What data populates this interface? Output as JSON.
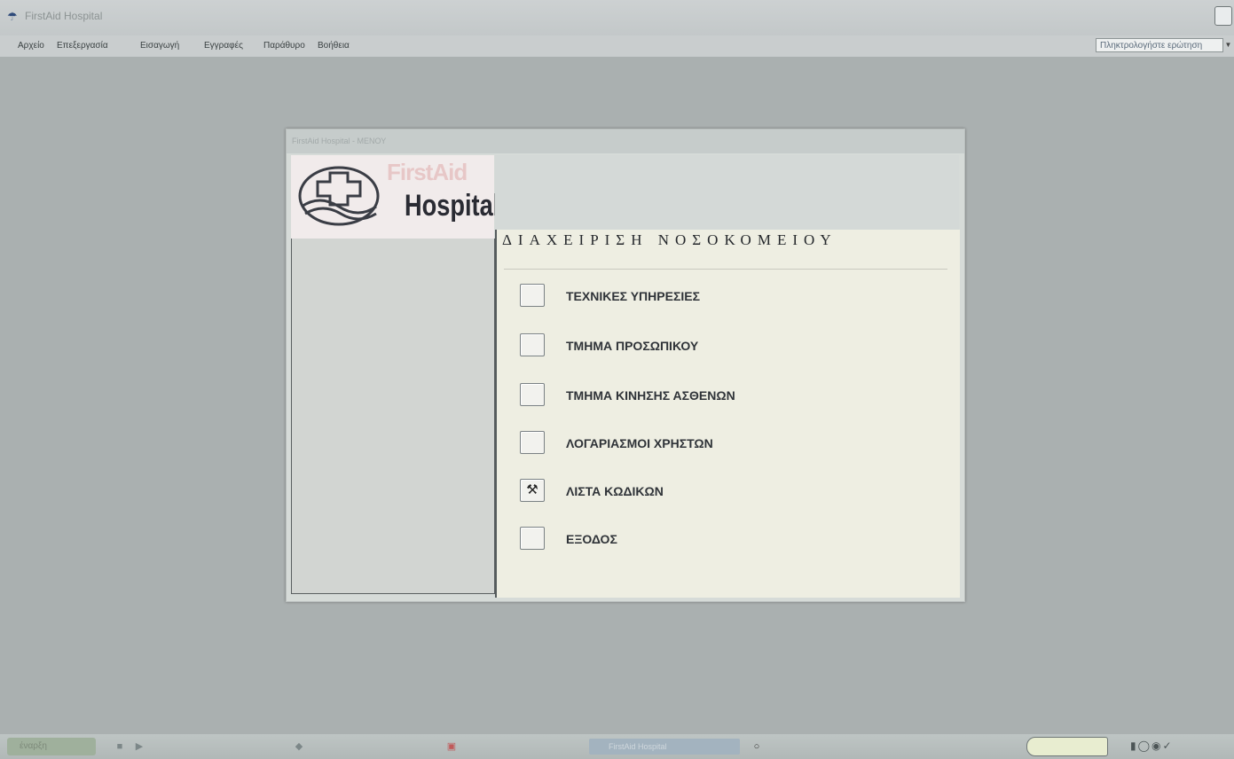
{
  "app": {
    "title": "FirstAid Hospital",
    "menu": [
      "Αρχείο",
      "Επεξεργασία",
      "Εισαγωγή",
      "Εγγραφές",
      "Παράθυρο",
      "Βοήθεια"
    ],
    "help_search_placeholder": "Πληκτρολογήστε ερώτηση"
  },
  "window": {
    "title": "FirstAid Hospital - ΜΕΝΟΥ",
    "logo": {
      "line1": "FirstAid",
      "line2": "Hospital"
    },
    "heading": "ΔΙΑΧΕΙΡΙΣΗ ΝΟΣΟΚΟΜΕΙΟΥ",
    "menu_items": [
      {
        "label": "ΤΕΧΝΙΚΕΣ ΥΠΗΡΕΣΙΕΣ",
        "icon": ""
      },
      {
        "label": "ΤΜΗΜΑ ΠΡΟΣΩΠΙΚΟΥ",
        "icon": ""
      },
      {
        "label": "ΤΜΗΜΑ ΚΙΝΗΣΗΣ ΑΣΘΕΝΩΝ",
        "icon": ""
      },
      {
        "label": "ΛΟΓΑΡΙΑΣΜΟΙ ΧΡΗΣΤΩΝ",
        "icon": ""
      },
      {
        "label": "ΛΙΣΤΑ ΚΩΔΙΚΩΝ",
        "icon": "hammer-icon"
      },
      {
        "label": "ΕΞΟΔΟΣ",
        "icon": ""
      }
    ]
  },
  "taskbar": {
    "start_label": "έναρξη",
    "active_app_label": "FirstAid Hospital"
  },
  "colors": {
    "desktop": "#aab0b0",
    "main_panel": "#eeeee2",
    "logo_accent": "#e7c7c7"
  }
}
